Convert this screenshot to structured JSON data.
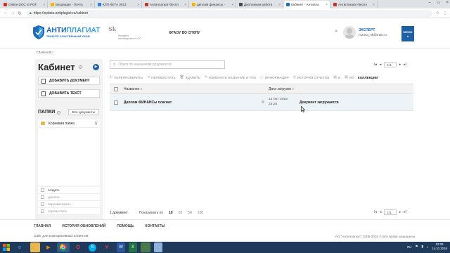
{
  "browser": {
    "tabs": [
      {
        "label": "Online DOC to PDF",
        "color": "#d93025",
        "active": false
      },
      {
        "label": "Входящие - Почта",
        "color": "#f4b400",
        "active": false
      },
      {
        "label": "КЛП ЛЕТА 2013",
        "color": "#2f7de1",
        "active": false
      },
      {
        "label": "Антиплагиат-беспл",
        "color": "#c0392b",
        "active": false
      },
      {
        "label": "диплом финансы - ",
        "color": "#f4b400",
        "active": false
      },
      {
        "label": "Дипломная работа",
        "color": "#4a4a4a",
        "active": false
      },
      {
        "label": "Кабинет - Антипла",
        "color": "#1e6bb8",
        "active": true
      },
      {
        "label": "Антиплагиат-беспл",
        "color": "#c0392b",
        "active": false
      }
    ],
    "url": "https://spbstu.antiplagiat.ru/cabinet"
  },
  "header": {
    "brand_part1": "АНТИ",
    "brand_part2": "ПЛАГИАТ",
    "slogan": "ТВОРИТЕ СОБСТВЕННЫМ УМОМ",
    "sk_mark": "Sk",
    "sk_text_line1": "Резидент",
    "sk_text_line2": "инновационного ОО",
    "org": "ФГАОУ ВО СПбПУ",
    "user_role": "ЭКСПЕРТ",
    "user_email": "rozova_nk@mail.ru",
    "menu_label": "МЕНЮ"
  },
  "breadcrumb": "ГЛАВНАЯ /",
  "left": {
    "title": "Кабинет",
    "add_document": "ДОБАВИТЬ ДОКУМЕНТ",
    "add_text": "ДОБАВИТЬ ТЕКСТ",
    "folders_title": "ПАПКИ",
    "all_documents": "Все документы",
    "folders": [
      {
        "name": "Корневая папка",
        "count": "1"
      }
    ],
    "folder_actions": {
      "create": "создать",
      "delete": "удалить",
      "rename": "переименовать",
      "move": "переместить"
    }
  },
  "main": {
    "search_placeholder": "Поиск по названиям документов",
    "pager": {
      "page": "1/1",
      "first": "I◂",
      "prev": "◂",
      "next": "▸",
      "last": "▸I"
    },
    "toolbar": {
      "recheck": "ПЕРЕПРОВЕРИТЬ",
      "move": "ПЕРЕМЕСТИТЬ",
      "delete": "УДАЛИТЬ",
      "rename": "ИЗМЕНИТЬ НАЗВАНИЕ И ТИП",
      "info": "ИНФОРМАЦИЯ",
      "history": "ИСТОРИЯ ОТЧЕТОВ",
      "in": "В",
      "from": "ИЗ",
      "collections": "КОЛЛЕКЦИИ"
    },
    "table": {
      "col_name": "Название",
      "col_date": "Дата загрузки",
      "rows": [
        {
          "name": "Диплом ФИНАНСы плагиат",
          "date": "14 Окт 2018",
          "time": "23:28",
          "status": "Документ загружается"
        }
      ]
    },
    "footer": {
      "count": "1 документ",
      "page_size_label": "Показывать по",
      "options": [
        "10",
        "20",
        "50",
        "100"
      ],
      "selected": "10"
    }
  },
  "site_footer": {
    "links": [
      "ГЛАВНАЯ",
      "ИСТОРИЯ ОБНОВЛЕНИЙ",
      "ПОМОЩЬ",
      "КОНТАКТЫ"
    ],
    "note": "Сайт для корпоративных клиентов",
    "copyright": "АО \"Антиплагиат\" 2005-2018 © Все права защищены"
  },
  "taskbar": {
    "time": "23:28",
    "date": "14.10.2018",
    "lang": "RU"
  }
}
